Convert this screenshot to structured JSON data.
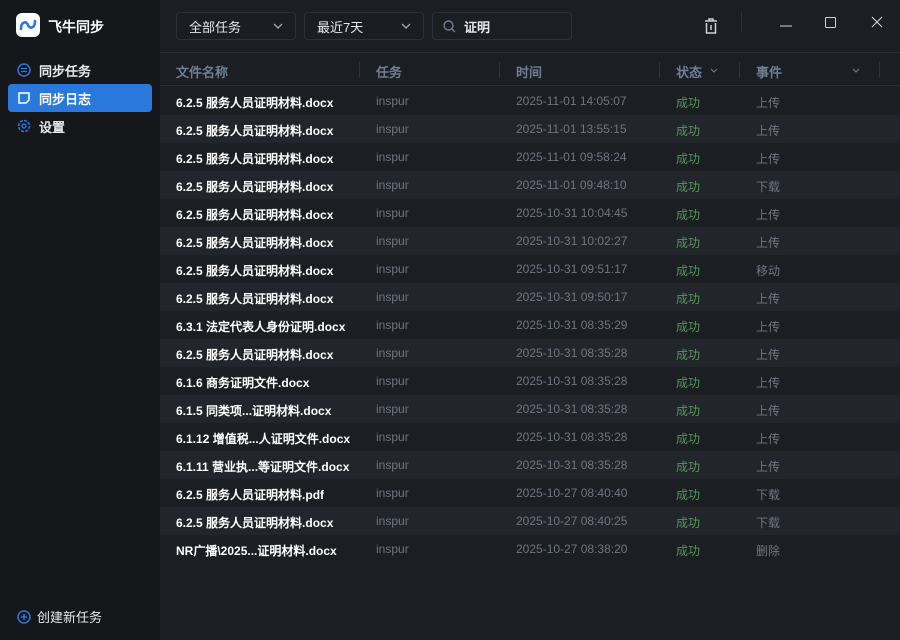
{
  "app": {
    "title": "飞牛同步"
  },
  "sidebar": {
    "items": [
      {
        "label": "同步任务"
      },
      {
        "label": "同步日志"
      },
      {
        "label": "设置"
      }
    ],
    "new_task": "创建新任务"
  },
  "toolbar": {
    "task_filter": "全部任务",
    "time_filter": "最近7天",
    "search_value": "证明"
  },
  "table": {
    "headers": [
      "文件名称",
      "任务",
      "时间",
      "状态",
      "事件"
    ],
    "rows": [
      [
        "6.2.5 服务人员证明材料.docx",
        "inspur",
        "2025-11-01 14:05:07",
        "成功",
        "上传"
      ],
      [
        "6.2.5 服务人员证明材料.docx",
        "inspur",
        "2025-11-01 13:55:15",
        "成功",
        "上传"
      ],
      [
        "6.2.5 服务人员证明材料.docx",
        "inspur",
        "2025-11-01 09:58:24",
        "成功",
        "上传"
      ],
      [
        "6.2.5 服务人员证明材料.docx",
        "inspur",
        "2025-11-01 09:48:10",
        "成功",
        "下载"
      ],
      [
        "6.2.5 服务人员证明材料.docx",
        "inspur",
        "2025-10-31 10:04:45",
        "成功",
        "上传"
      ],
      [
        "6.2.5 服务人员证明材料.docx",
        "inspur",
        "2025-10-31 10:02:27",
        "成功",
        "上传"
      ],
      [
        "6.2.5 服务人员证明材料.docx",
        "inspur",
        "2025-10-31 09:51:17",
        "成功",
        "移动"
      ],
      [
        "6.2.5 服务人员证明材料.docx",
        "inspur",
        "2025-10-31 09:50:17",
        "成功",
        "上传"
      ],
      [
        "6.3.1 法定代表人身份证明.docx",
        "inspur",
        "2025-10-31 08:35:29",
        "成功",
        "上传"
      ],
      [
        "6.2.5 服务人员证明材料.docx",
        "inspur",
        "2025-10-31 08:35:28",
        "成功",
        "上传"
      ],
      [
        "6.1.6 商务证明文件.docx",
        "inspur",
        "2025-10-31 08:35:28",
        "成功",
        "上传"
      ],
      [
        "6.1.5 同类项...证明材料.docx",
        "inspur",
        "2025-10-31 08:35:28",
        "成功",
        "上传"
      ],
      [
        "6.1.12 增值税...人证明文件.docx",
        "inspur",
        "2025-10-31 08:35:28",
        "成功",
        "上传"
      ],
      [
        "6.1.11 营业执...等证明文件.docx",
        "inspur",
        "2025-10-31 08:35:28",
        "成功",
        "上传"
      ],
      [
        "6.2.5 服务人员证明材料.pdf",
        "inspur",
        "2025-10-27 08:40:40",
        "成功",
        "下载"
      ],
      [
        "6.2.5 服务人员证明材料.docx",
        "inspur",
        "2025-10-27 08:40:25",
        "成功",
        "下载"
      ],
      [
        "NR广播\\2025...证明材料.docx",
        "inspur",
        "2025-10-27 08:38:20",
        "成功",
        "删除"
      ]
    ]
  },
  "colors": {
    "accent": "#2a78dc",
    "success": "#4e9a52"
  }
}
